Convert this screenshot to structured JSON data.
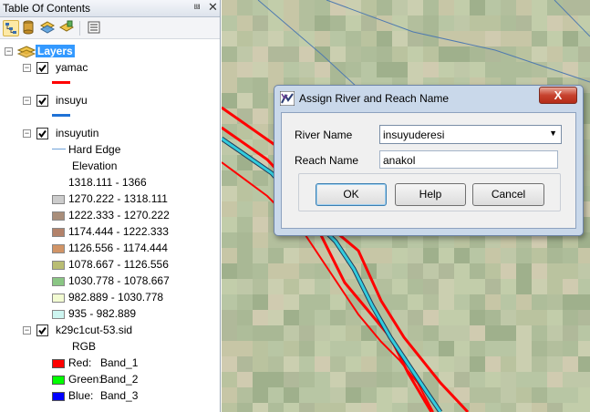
{
  "toc": {
    "title": "Table Of Contents",
    "pin_icon": "pin-icon",
    "close_icon": "close-icon",
    "toolbar_icons": [
      "list-by-drawing-order-icon",
      "list-by-source-icon",
      "list-by-visibility-icon",
      "list-by-selection-icon",
      "options-icon"
    ],
    "root": {
      "label": "Layers",
      "expanded": true
    },
    "layers": {
      "yamac": {
        "label": "yamac",
        "checked": true,
        "symbol_color": "#ff0000"
      },
      "insuyu": {
        "label": "insuyu",
        "checked": true,
        "symbol_color": "#1f72d6"
      },
      "insuyutin": {
        "label": "insuyutin",
        "checked": true,
        "edge_label": "Hard Edge",
        "edge_color": "#6fa3d8",
        "elevation_label": "Elevation",
        "classes": [
          {
            "label": "1318.111 - 1366",
            "color": "#ffffff"
          },
          {
            "label": "1270.222 - 1318.111",
            "color": "#cccccc"
          },
          {
            "label": "1222.333 - 1270.222",
            "color": "#a98e7a"
          },
          {
            "label": "1174.444 - 1222.333",
            "color": "#b3826a"
          },
          {
            "label": "1126.556 - 1174.444",
            "color": "#d19466"
          },
          {
            "label": "1078.667 - 1126.556",
            "color": "#b9bd73"
          },
          {
            "label": "1030.778 - 1078.667",
            "color": "#8ac684"
          },
          {
            "label": "982.889 - 1030.778",
            "color": "#f2fbd2"
          },
          {
            "label": "935 - 982.889",
            "color": "#cdf5f0"
          }
        ]
      },
      "k29": {
        "label": "k29c1cut-53.sid",
        "checked": true,
        "rgb_label": "RGB",
        "bands": [
          {
            "prefix": "Red:",
            "band": "Band_1",
            "color": "#ff0000"
          },
          {
            "prefix": "Green:",
            "band": "Band_2",
            "color": "#00ff00"
          },
          {
            "prefix": "Blue:",
            "band": "Band_3",
            "color": "#0000ff"
          }
        ]
      }
    }
  },
  "dialog": {
    "title": "Assign River and Reach Name",
    "close_label": "X",
    "river_label": "River Name",
    "river_value": "insuyuderesi",
    "reach_label": "Reach Name",
    "reach_value": "anakol",
    "ok_label": "OK",
    "help_label": "Help",
    "cancel_label": "Cancel"
  },
  "colors": {
    "selection": "#3399ff",
    "river_outline": "#ff0000",
    "river_center": "#33ccdd"
  }
}
